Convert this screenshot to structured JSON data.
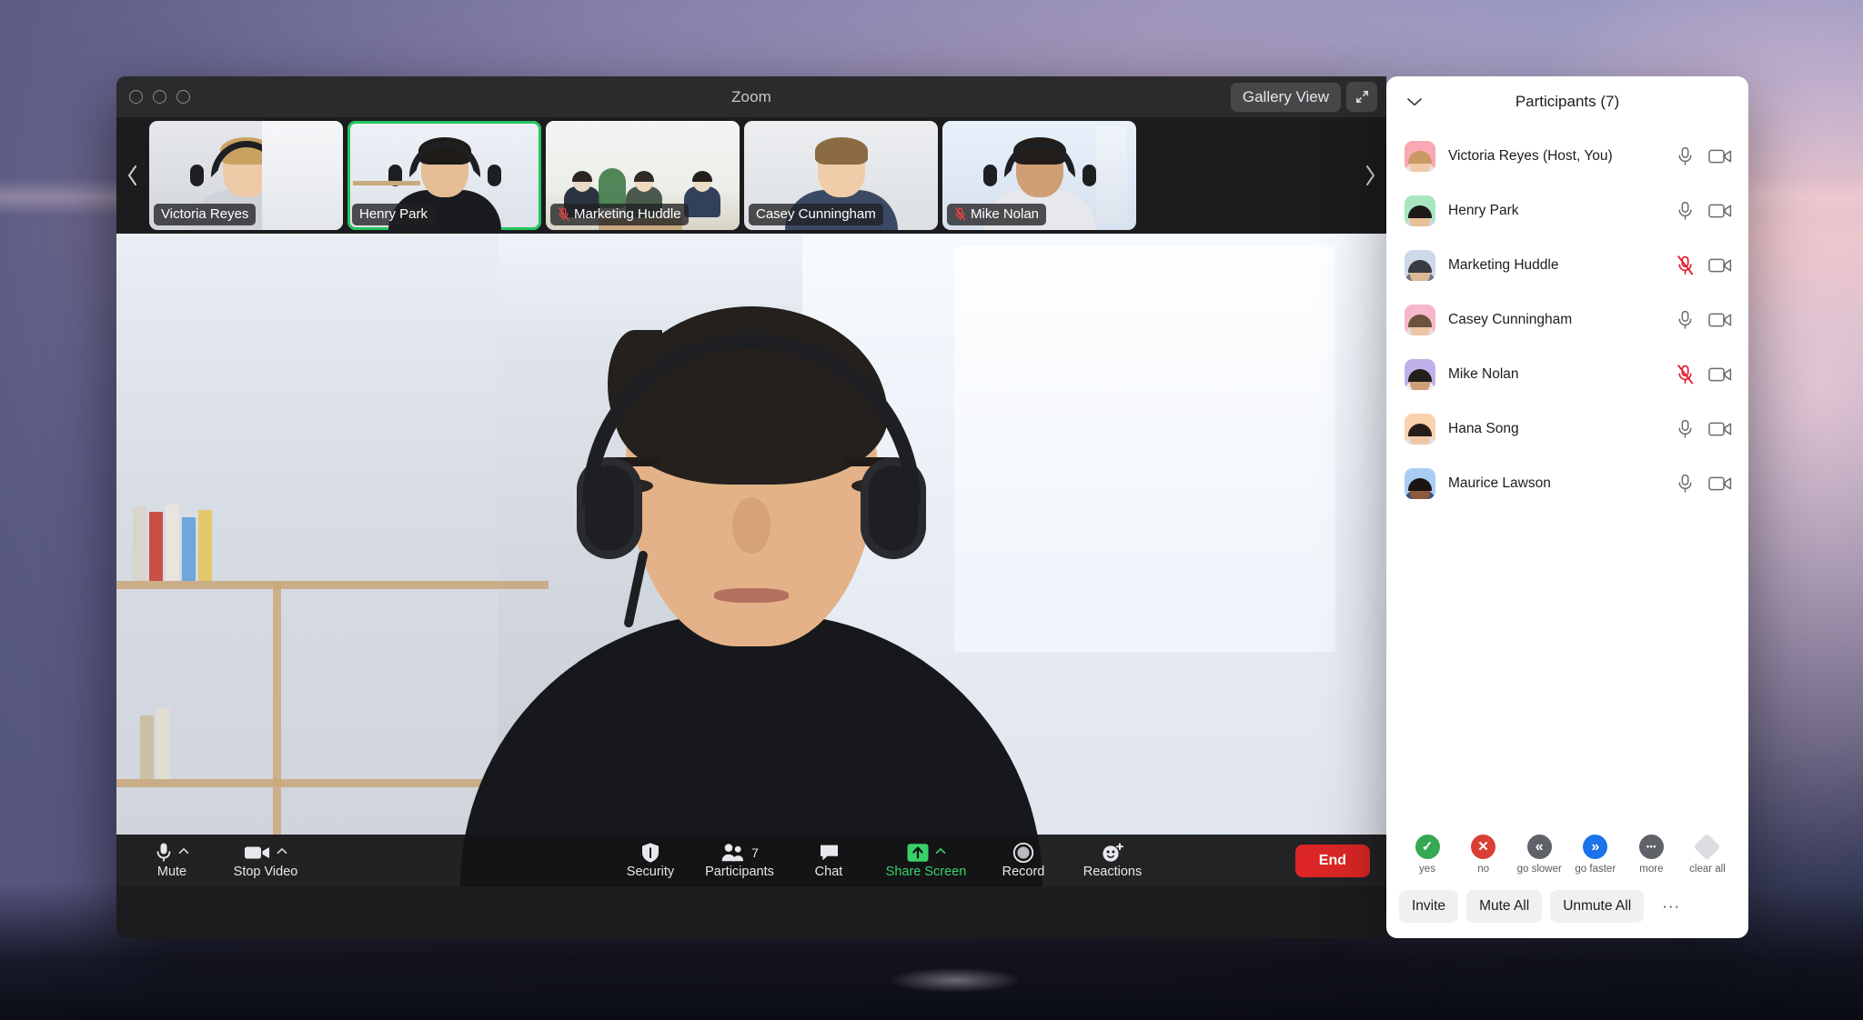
{
  "window": {
    "title": "Zoom",
    "traffic_lights": [
      "close",
      "minimize",
      "maximize"
    ],
    "view_mode_label": "Gallery View",
    "fullscreen_icon": "expand-diagonal-icon"
  },
  "filmstrip": {
    "prev_icon": "chevron-left-icon",
    "next_icon": "chevron-right-icon",
    "thumbnails": [
      {
        "name": "Victoria Reyes",
        "active_speaker": false,
        "muted": false
      },
      {
        "name": "Henry Park",
        "active_speaker": true,
        "muted": false
      },
      {
        "name": "Marketing Huddle",
        "active_speaker": false,
        "muted": true
      },
      {
        "name": "Casey Cunningham",
        "active_speaker": false,
        "muted": false
      },
      {
        "name": "Mike Nolan",
        "active_speaker": false,
        "muted": true
      }
    ]
  },
  "stage": {
    "speaker_name": "Henry Park"
  },
  "toolbar": {
    "mute_label": "Mute",
    "mute_icon": "microphone-icon",
    "stop_video_label": "Stop Video",
    "stop_video_icon": "video-camera-icon",
    "security_label": "Security",
    "security_icon": "shield-icon",
    "participants_label": "Participants",
    "participants_icon": "people-icon",
    "participants_count": "7",
    "chat_label": "Chat",
    "chat_icon": "chat-bubble-icon",
    "share_screen_label": "Share Screen",
    "share_screen_icon": "share-arrow-up-icon",
    "record_label": "Record",
    "record_icon": "record-circle-icon",
    "reactions_label": "Reactions",
    "reactions_icon": "smiley-plus-icon",
    "end_label": "End",
    "caret_icon": "chevron-up-icon",
    "accent_green": "#38d16a",
    "end_red": "#dc2626"
  },
  "participants_panel": {
    "collapse_icon": "chevron-down-icon",
    "title": "Participants (7)",
    "count": 7,
    "mic_icon": "microphone-icon",
    "mic_muted_icon": "microphone-muted-icon",
    "video_icon": "video-camera-icon",
    "muted_color": "#e11d2e",
    "rows": [
      {
        "name": "Victoria Reyes (Host, You)",
        "muted": false,
        "video_on": true,
        "avatar_bg": "#f9a8b4",
        "hair": "#c99a63",
        "skin": "#f0c9a8",
        "shirt": "#e7e2de"
      },
      {
        "name": "Henry Park",
        "muted": false,
        "video_on": true,
        "avatar_bg": "#a8e6c0",
        "hair": "#1d1a18",
        "skin": "#e8bf96",
        "shirt": "#cfd6d9"
      },
      {
        "name": "Marketing Huddle",
        "muted": true,
        "video_on": true,
        "avatar_bg": "#cfd8e8",
        "hair": "#3a3a42",
        "skin": "#ddb894",
        "shirt": "#6e7684"
      },
      {
        "name": "Casey Cunningham",
        "muted": false,
        "video_on": true,
        "avatar_bg": "#f6b8cc",
        "hair": "#6b5340",
        "skin": "#eec6a4",
        "shirt": "#e3e3e6"
      },
      {
        "name": "Mike Nolan",
        "muted": true,
        "video_on": true,
        "avatar_bg": "#c0b0ea",
        "hair": "#241f1c",
        "skin": "#cf9f76",
        "shirt": "#efeff2"
      },
      {
        "name": "Hana Song",
        "muted": false,
        "video_on": true,
        "avatar_bg": "#fbd2ae",
        "hair": "#261d18",
        "skin": "#f0c7a5",
        "shirt": "#dfe1e6"
      },
      {
        "name": "Maurice Lawson",
        "muted": false,
        "video_on": true,
        "avatar_bg": "#a9cdf4",
        "hair": "#1a1512",
        "skin": "#8d5b3c",
        "shirt": "#39507a"
      }
    ],
    "reactions": [
      {
        "label": "yes",
        "icon": "check-circle-icon",
        "glyph": "✓",
        "color": "#34a853"
      },
      {
        "label": "no",
        "icon": "x-circle-icon",
        "glyph": "✕",
        "color": "#d93f32"
      },
      {
        "label": "go slower",
        "icon": "rewind-icon",
        "glyph": "«",
        "color": "#5f6368"
      },
      {
        "label": "go faster",
        "icon": "fast-forward-icon",
        "glyph": "»",
        "color": "#1a73e8"
      },
      {
        "label": "more",
        "icon": "ellipsis-circle-icon",
        "glyph": "•••",
        "color": "#5f6368"
      },
      {
        "label": "clear all",
        "icon": "clear-diamond-icon",
        "glyph": "",
        "color": "#dcdce1"
      }
    ],
    "actions": {
      "invite": "Invite",
      "mute_all": "Mute All",
      "unmute_all": "Unmute All",
      "more": "···"
    }
  }
}
